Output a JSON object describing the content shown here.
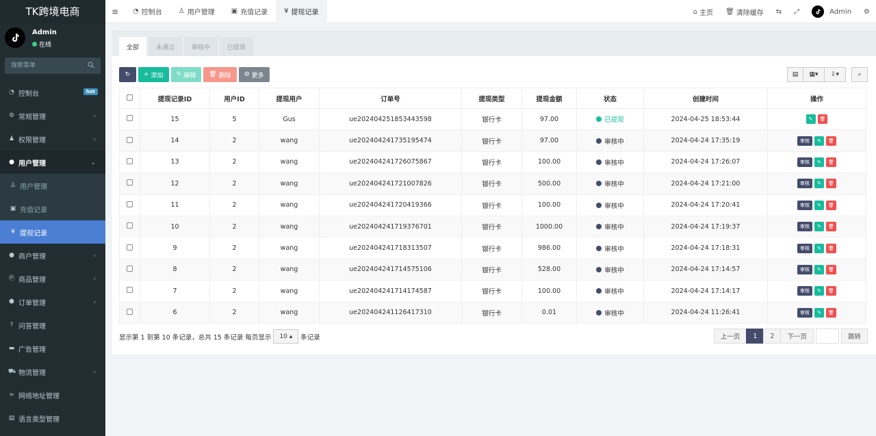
{
  "brand": "TK跨境电商",
  "user": {
    "name": "Admin",
    "status": "在线"
  },
  "search": {
    "placeholder": "搜索菜单"
  },
  "sidebar": {
    "items": [
      {
        "label": "控制台",
        "icon": "dashboard-icon",
        "badge": "hot"
      },
      {
        "label": "常规管理",
        "icon": "cogs-icon"
      },
      {
        "label": "权限管理",
        "icon": "group-icon"
      },
      {
        "label": "用户管理",
        "icon": "user-circle-icon"
      },
      {
        "label": "用户管理",
        "icon": "user-icon"
      },
      {
        "label": "充值记录",
        "icon": "money-icon"
      },
      {
        "label": "提现记录",
        "icon": "yen-icon"
      },
      {
        "label": "商户管理",
        "icon": "apple-icon"
      },
      {
        "label": "商品管理",
        "icon": "product-hunt-icon"
      },
      {
        "label": "订单管理",
        "icon": "cube-icon"
      },
      {
        "label": "问答管理",
        "icon": "question-icon"
      },
      {
        "label": "广告管理",
        "icon": "credit-card-icon"
      },
      {
        "label": "物流管理",
        "icon": "truck-icon"
      },
      {
        "label": "网络地址管理",
        "icon": "link-icon"
      },
      {
        "label": "语言类型管理",
        "icon": "book-icon"
      }
    ]
  },
  "topbar": {
    "tabs": [
      {
        "label": "控制台",
        "icon": "dashboard-icon"
      },
      {
        "label": "用户管理",
        "icon": "user-icon"
      },
      {
        "label": "充值记录",
        "icon": "money-icon"
      },
      {
        "label": "提现记录",
        "icon": "yen-icon"
      }
    ],
    "home": "主页",
    "clear_cache": "清除缓存",
    "user": "Admin"
  },
  "filter_tabs": [
    "全部",
    "未通过",
    "审核中",
    "已提现"
  ],
  "toolbar": {
    "add": "添加",
    "edit": "编辑",
    "delete": "删除",
    "more": "更多"
  },
  "table": {
    "headers": [
      "提现记录ID",
      "用户ID",
      "提现用户",
      "订单号",
      "提现类型",
      "提现金额",
      "状态",
      "创建时间",
      "操作"
    ],
    "review_label": "审核",
    "rows": [
      {
        "id": "15",
        "uid": "5",
        "user": "Gus",
        "order": "ue202404251853443598",
        "type": "银行卡",
        "amount": "97.00",
        "status": "已提现",
        "time": "2024-04-25 18:53:44"
      },
      {
        "id": "14",
        "uid": "2",
        "user": "wang",
        "order": "ue202404241735195474",
        "type": "银行卡",
        "amount": "97.00",
        "status": "审核中",
        "time": "2024-04-24 17:35:19"
      },
      {
        "id": "13",
        "uid": "2",
        "user": "wang",
        "order": "ue202404241726075867",
        "type": "银行卡",
        "amount": "100.00",
        "status": "审核中",
        "time": "2024-04-24 17:26:07"
      },
      {
        "id": "12",
        "uid": "2",
        "user": "wang",
        "order": "ue202404241721007826",
        "type": "银行卡",
        "amount": "500.00",
        "status": "审核中",
        "time": "2024-04-24 17:21:00"
      },
      {
        "id": "11",
        "uid": "2",
        "user": "wang",
        "order": "ue202404241720419366",
        "type": "银行卡",
        "amount": "100.00",
        "status": "审核中",
        "time": "2024-04-24 17:20:41"
      },
      {
        "id": "10",
        "uid": "2",
        "user": "wang",
        "order": "ue202404241719376701",
        "type": "银行卡",
        "amount": "1000.00",
        "status": "审核中",
        "time": "2024-04-24 17:19:37"
      },
      {
        "id": "9",
        "uid": "2",
        "user": "wang",
        "order": "ue202404241718313507",
        "type": "银行卡",
        "amount": "986.00",
        "status": "审核中",
        "time": "2024-04-24 17:18:31"
      },
      {
        "id": "8",
        "uid": "2",
        "user": "wang",
        "order": "ue202404241714575106",
        "type": "银行卡",
        "amount": "528.00",
        "status": "审核中",
        "time": "2024-04-24 17:14:57"
      },
      {
        "id": "7",
        "uid": "2",
        "user": "wang",
        "order": "ue202404241714174587",
        "type": "银行卡",
        "amount": "100.00",
        "status": "审核中",
        "time": "2024-04-24 17:14:17"
      },
      {
        "id": "6",
        "uid": "2",
        "user": "wang",
        "order": "ue202404241126417310",
        "type": "银行卡",
        "amount": "0.01",
        "status": "审核中",
        "time": "2024-04-24 11:26:41"
      }
    ]
  },
  "footer": {
    "summary": "显示第 1 到第 10 条记录，总共 15 条记录 每页显示",
    "page_size": "10",
    "suffix": "条记录"
  },
  "pagination": {
    "prev": "上一页",
    "pages": [
      "1",
      "2"
    ],
    "next": "下一页",
    "jump": "跳转"
  },
  "colors": {
    "sidebar": "#222d32",
    "active": "#4a7fd4",
    "success": "#18bc9c",
    "primary": "#444c6b",
    "danger": "#f05050"
  }
}
